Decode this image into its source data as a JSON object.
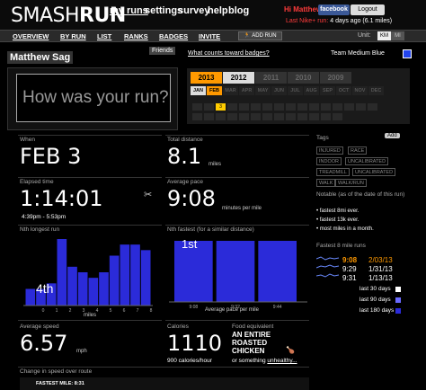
{
  "header": {
    "logo_a": "SMASH",
    "logo_b": "RUN",
    "nav": [
      "my runs",
      "settings",
      "survey",
      "help",
      "blog"
    ],
    "greeting": "Hi Matthew",
    "facebook": "facebook",
    "logout": "Logout",
    "last_run_label": "Last Nike+ run:",
    "last_run_value": "4 days ago (6.1 miles)"
  },
  "subnav": {
    "items": [
      "OVERVIEW",
      "BY RUN",
      "LIST",
      "RANKS",
      "BADGES",
      "INVITE"
    ],
    "add_run": "ADD RUN",
    "unit_label": "Unit:",
    "unit_km": "KM",
    "unit_mi": "MI"
  },
  "profile": {
    "name": "Matthew Sag",
    "friends": "Friends",
    "placeholder": "How was your run?",
    "badges_link": "What counts toward badges?",
    "team": "Team Medium Blue"
  },
  "calendar": {
    "years": [
      "2013",
      "2012",
      "2011",
      "2010",
      "2009"
    ],
    "selected_year": "2013",
    "months": [
      "JAN",
      "FEB",
      "MAR",
      "APR",
      "MAY",
      "JUN",
      "JUL",
      "AUG",
      "SEP",
      "OCT",
      "NOV",
      "DEC"
    ],
    "selected_month": "FEB",
    "highlight_day": "3"
  },
  "stats": {
    "when_label": "When",
    "when_value": "FEB 3",
    "distance_label": "Total distance",
    "distance_value": "8.1",
    "distance_unit": "miles",
    "elapsed_label": "Elapsed time",
    "elapsed_value": "1:14:01",
    "elapsed_range": "4:39pm - 5:53pm",
    "pace_label": "Average pace",
    "pace_value": "9:08",
    "pace_unit": "minutes per mile",
    "speed_label": "Average speed",
    "speed_value": "6.57",
    "speed_unit": "mph",
    "calories_label": "Calories",
    "calories_value": "1110",
    "calories_sub": "900 calories/hour",
    "food_label": "Food equivalent",
    "food_value": "AN ENTIRE ROASTED CHICKEN",
    "food_sub": "or something",
    "food_link": "unhealthy...",
    "change_label": "Change in speed over route",
    "fastest_mile": "FASTEST MILE: 8:31"
  },
  "tags": {
    "title": "Tags",
    "add": "Add",
    "items": [
      "INJURED",
      "RACE",
      "INDOOR",
      "UNCALIBRATED",
      "TREADMILL",
      "UNCALIBRATED",
      "WALK",
      "WALK/RUN"
    ]
  },
  "notable": {
    "title": "Notable (as of the date of this run)",
    "items": [
      "fastest 8mi ever.",
      "fastest 13k ever.",
      "most miles in a month."
    ]
  },
  "fastest_runs": {
    "title": "Fastest 8 mile runs",
    "rows": [
      {
        "time": "9:08",
        "date": "2/03/13"
      },
      {
        "time": "9:29",
        "date": "1/31/13"
      },
      {
        "time": "9:31",
        "date": "1/13/13"
      }
    ],
    "legend": [
      "last 30 days",
      "last 90 days",
      "last 180 days"
    ],
    "legend_colors": [
      "#ffffff",
      "#6a6aff",
      "#2b2bd9"
    ]
  },
  "chart_longest": {
    "title": "Nth longest run",
    "rank_label": "4th",
    "xlabel": "miles",
    "tick_labels": [
      "0",
      "1",
      "2",
      "3",
      "4",
      "5",
      "6",
      "7",
      "8"
    ]
  },
  "chart_fastest": {
    "title": "Nth fastest (for a similar distance)",
    "rank_label": "1st",
    "xlabel": "Average pace per mile",
    "tick_labels": [
      "9:08",
      "9:32",
      "9:44"
    ]
  },
  "chart_data": [
    {
      "type": "bar",
      "title": "Nth longest run",
      "xlabel": "miles",
      "values": [
        3,
        3,
        4,
        12,
        7,
        6,
        5,
        6,
        9,
        11,
        11,
        10
      ]
    },
    {
      "type": "bar",
      "title": "Nth fastest (for a similar distance)",
      "xlabel": "Average pace per mile",
      "categories": [
        "9:08",
        "9:32",
        "9:44"
      ],
      "values": [
        1,
        1,
        1
      ]
    }
  ]
}
